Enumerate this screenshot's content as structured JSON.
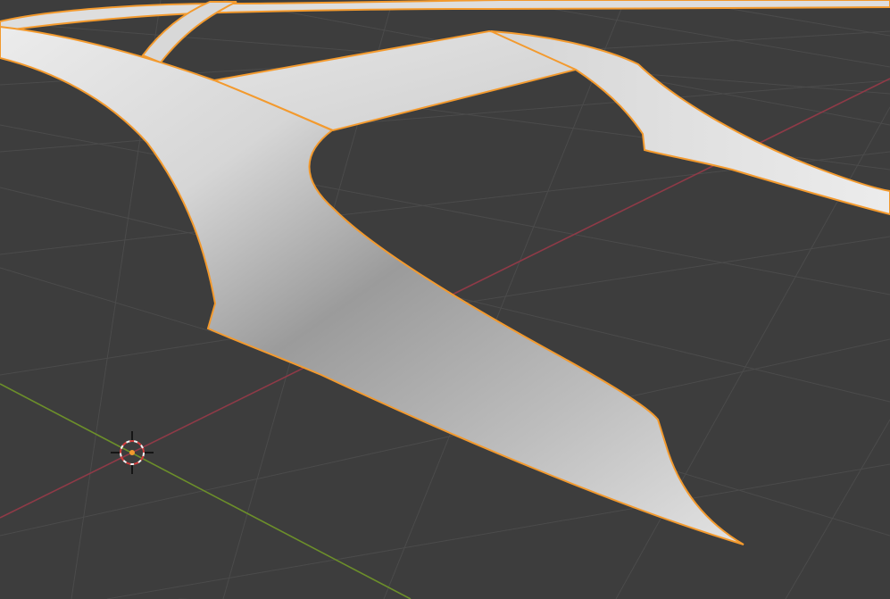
{
  "viewport": {
    "background_color": "#3d3d3d",
    "grid_color": "#4a4a4a",
    "x_axis_color": "#8f3a47",
    "y_axis_color": "#6c8f2a",
    "selection_outline_color": "#f39a2e",
    "mesh_color": "#d9d9d9",
    "mesh_shadow_color": "#8e8e8e",
    "cursor_icon": "3d-cursor-icon",
    "object_selected": true
  }
}
